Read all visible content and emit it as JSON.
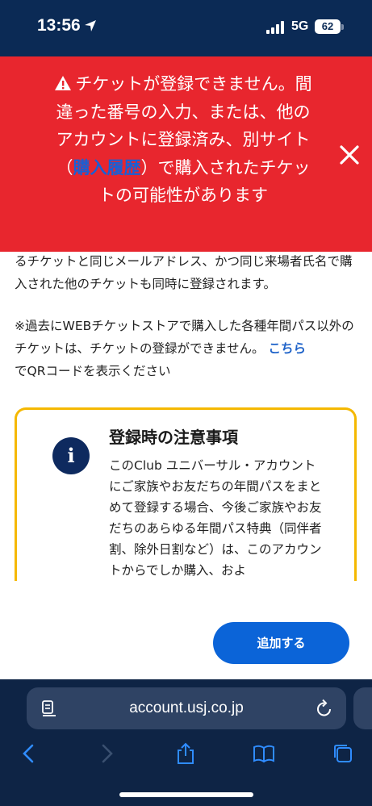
{
  "status_bar": {
    "time": "13:56",
    "network": "5G",
    "battery": "62"
  },
  "error_banner": {
    "text_before_link": "チケットが登録できません。間違った番号の入力、または、他のアカウントに登録済み、別サイト（",
    "link_text": "購入履歴",
    "text_after_link": "）で購入されたチケットの可能性があります",
    "icon": "warning-icon",
    "close_icon": "close-icon"
  },
  "page": {
    "paragraph1": "るチケットと同じメールアドレス、かつ同じ来場者氏名で購入された他のチケットも同時に登録されます。",
    "paragraph2_text": "※過去にWEBチケットストアで購入した各種年間パス以外のチケットは、チケットの登録ができません。",
    "paragraph2_link": "こちら",
    "paragraph2_tail": "でQRコードを表示ください",
    "notice": {
      "title": "登録時の注意事項",
      "body": "このClub ユニバーサル・アカウントにご家族やお友だちの年間パスをまとめて登録する場合、今後ご家族やお友だちのあらゆる年間パス特典（同伴者割、除外日割など）は、このアカウントからでしか購入、およ",
      "icon_glyph": "i"
    },
    "add_button_label": "追加する"
  },
  "browser": {
    "url": "account.usj.co.jp"
  },
  "colors": {
    "banner_red": "#e8262e",
    "navy": "#0b2a55",
    "notice_border": "#f5b800",
    "button_blue": "#0b64d8",
    "link_blue": "#1f63c9"
  }
}
